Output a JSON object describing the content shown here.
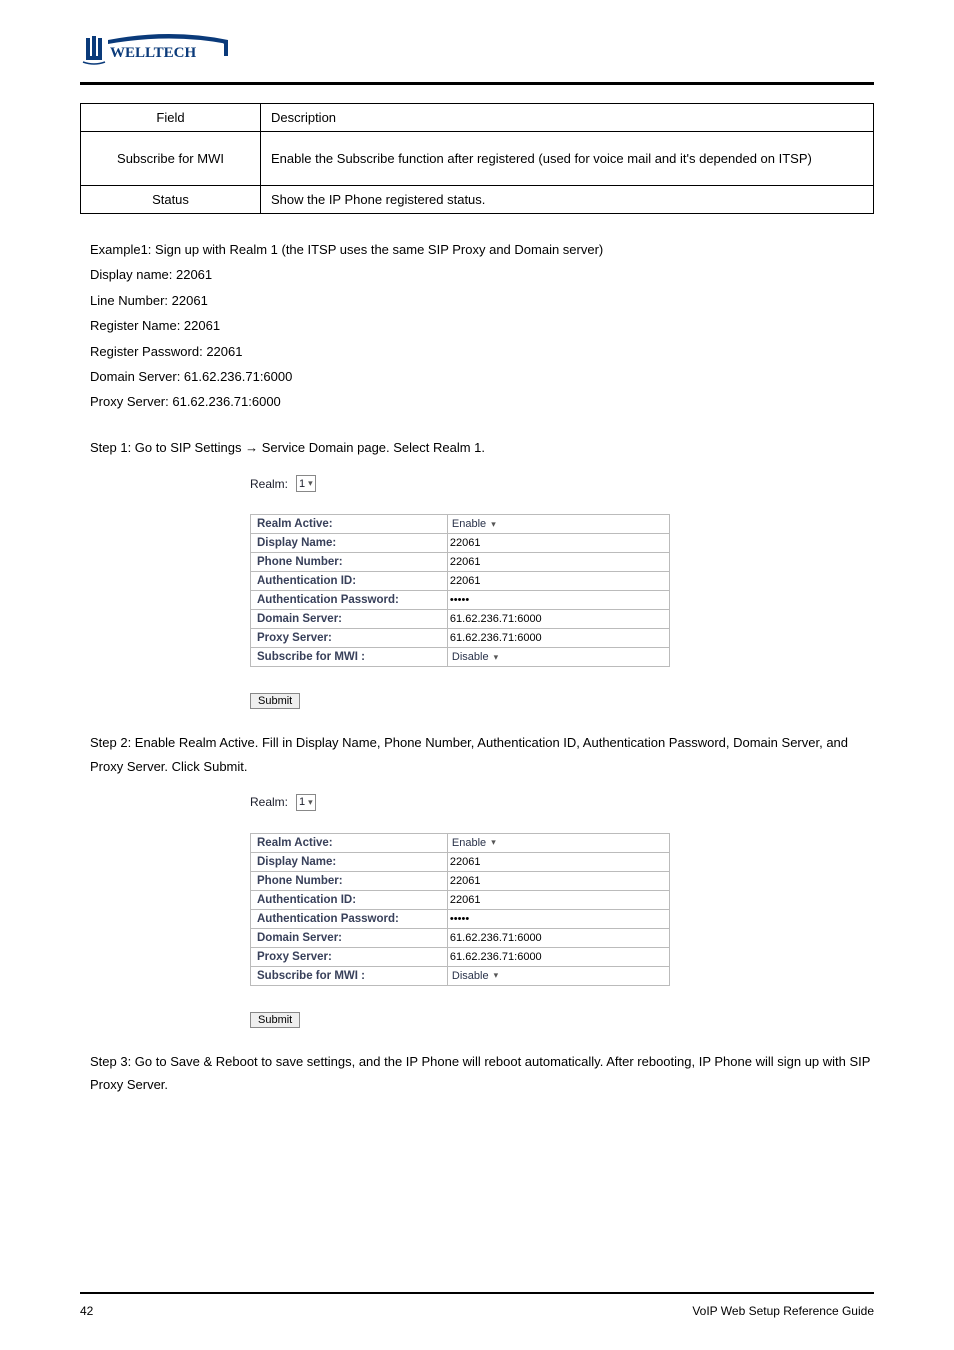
{
  "header": {
    "logo_text": "WELLTECH"
  },
  "main_table": {
    "r1_l": "Field",
    "r1_r": "Description",
    "r2_l": "Subscribe for MWI",
    "r2_r": "Enable the Subscribe function after registered (used for voice mail and it's depended on ITSP)",
    "r3_l": "Status",
    "r3_r": "Show the IP Phone registered status."
  },
  "examples_title": "Example1: Sign up with Realm 1 (the ITSP uses the same SIP Proxy and Domain server)",
  "bullets": [
    "Display name: 22061",
    "Line Number: 22061",
    "Register Name: 22061",
    "Register Password: 22061",
    "Domain Server: 61.62.236.71:6000",
    "Proxy Server: 61.62.236.71:6000"
  ],
  "steps": [
    "Step 1: Go to SIP Settings → Service Domain page. Select Realm 1.",
    "Step 2: Enable Realm Active. Fill in Display Name, Phone Number, Authentication ID, Authentication Password, Domain Server, and Proxy Server. Click Submit."
  ],
  "form": {
    "realm_label": "Realm:",
    "realm_value": "1",
    "rows": [
      {
        "label": "Realm Active:",
        "type": "select",
        "value": "Enable"
      },
      {
        "label": "Display Name:",
        "type": "text",
        "value": "22061"
      },
      {
        "label": "Phone Number:",
        "type": "text",
        "value": "22061"
      },
      {
        "label": "Authentication ID:",
        "type": "text",
        "value": "22061"
      },
      {
        "label": "Authentication Password:",
        "type": "password",
        "value": "•••••"
      },
      {
        "label": "Domain Server:",
        "type": "text",
        "value": "61.62.236.71:6000"
      },
      {
        "label": "Proxy Server:",
        "type": "text",
        "value": "61.62.236.71:6000"
      },
      {
        "label": "Subscribe for MWI :",
        "type": "select",
        "value": "Disable"
      }
    ],
    "submit": "Submit"
  },
  "steps2": [
    "Step 3: Go to Save & Reboot to save settings, and the IP Phone will reboot automatically. After rebooting, IP Phone will sign up with SIP Proxy Server."
  ],
  "footer": {
    "left": "42",
    "right": "VoIP Web Setup Reference Guide"
  }
}
